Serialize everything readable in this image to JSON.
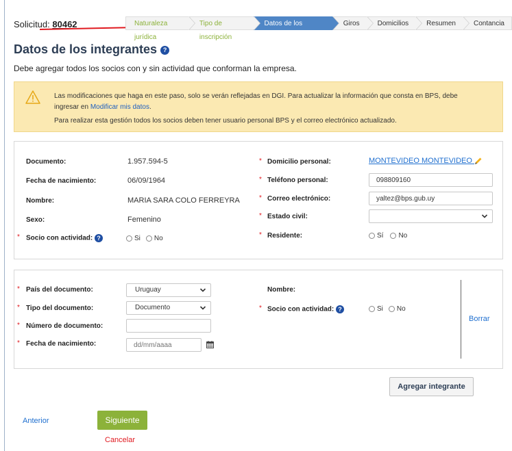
{
  "header": {
    "solicitud_label": "Solicitud:",
    "solicitud_number": "80462",
    "steps": [
      {
        "label": "Naturaleza jurídica",
        "state": "done"
      },
      {
        "label": "Tipo de inscripción",
        "state": "done"
      },
      {
        "label": "Datos de los integrantes",
        "state": "active"
      },
      {
        "label": "Giros",
        "state": "pending"
      },
      {
        "label": "Domicilios",
        "state": "pending"
      },
      {
        "label": "Resumen",
        "state": "pending"
      },
      {
        "label": "Contancia",
        "state": "pending"
      }
    ]
  },
  "page": {
    "title": "Datos de los integrantes",
    "subtitle": "Debe agregar todos los socios con y sin actividad que conforman la empresa."
  },
  "alert": {
    "line1": "Las modificaciones que haga en este paso, solo se verán reflejadas en DGI. Para actualizar la información que consta en BPS, debe",
    "line2_prefix": "ingresar en ",
    "line2_link": "Modificar mis datos",
    "line2_suffix": ".",
    "line3": "Para realizar esta gestión todos los socios deben tener usuario personal BPS y el correo electrónico actualizado."
  },
  "member": {
    "documento_label": "Documento:",
    "documento_value": "1.957.594-5",
    "fecha_label": "Fecha de nacimiento:",
    "fecha_value": "06/09/1964",
    "nombre_label": "Nombre:",
    "nombre_value": "MARIA SARA COLO FERREYRA",
    "sexo_label": "Sexo:",
    "sexo_value": "Femenino",
    "socio_label": "Socio con actividad:",
    "opt_si": "Si",
    "opt_no": "No",
    "domicilio_label": "Domicilio personal:",
    "domicilio_value": "MONTEVIDEO MONTEVIDEO",
    "telefono_label": "Teléfono personal:",
    "telefono_value": "098809160",
    "correo_label": "Correo electrónico:",
    "correo_value": "yaltez@bps.gub.uy",
    "estado_label": "Estado civil:",
    "estado_value": "",
    "residente_label": "Residente:",
    "res_si": "Sí",
    "res_no": "No"
  },
  "new_member": {
    "pais_label": "País del documento:",
    "pais_value": "Uruguay",
    "tipo_label": "Tipo del documento:",
    "tipo_value": "Documento",
    "numero_label": "Número de documento:",
    "numero_value": "",
    "fecha_label": "Fecha de nacimiento:",
    "fecha_placeholder": "dd/mm/aaaa",
    "nombre_label": "Nombre:",
    "socio_label": "Socio con actividad:",
    "opt_si": "Si",
    "opt_no": "No",
    "borrar": "Borrar"
  },
  "actions": {
    "agregar": "Agregar integrante",
    "anterior": "Anterior",
    "siguiente": "Siguiente",
    "cancelar": "Cancelar"
  },
  "colors": {
    "accent_blue": "#4f86c6",
    "green": "#8cb23a",
    "required_red": "#e0191f",
    "alert_bg": "#fbe9b2"
  }
}
